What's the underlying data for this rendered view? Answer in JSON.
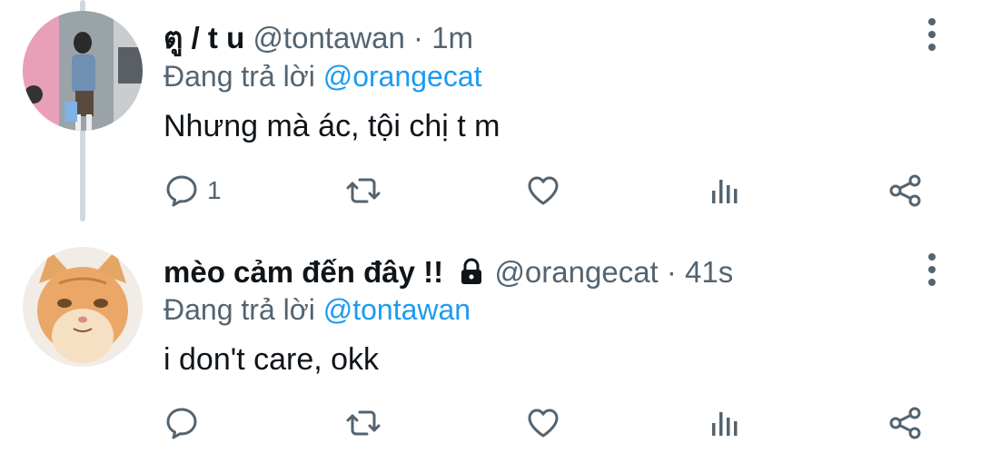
{
  "tweets": [
    {
      "display_name": "ตู / t u",
      "handle": "@tontawan",
      "time": "· 1m",
      "reply_prefix": "Đang trả lời",
      "reply_to": "@orangecat",
      "text": "Nhưng mà ác, tội chị t m",
      "reply_count": "1",
      "avatar": "girl-photo-avatar"
    },
    {
      "display_name": "mèo cảm đến đây !!",
      "handle": "@orangecat",
      "time": "· 41s",
      "reply_prefix": "Đang trả lời",
      "reply_to": "@tontawan",
      "text": "i don't care, okk",
      "reply_count": "",
      "avatar": "orange-cat-avatar",
      "protected": true
    }
  ],
  "icons": {
    "reply": "reply-bubble-icon",
    "retweet": "retweet-icon",
    "like": "heart-icon",
    "analytics": "analytics-bars-icon",
    "share": "share-icon",
    "more": "more-vertical-icon",
    "lock": "lock-icon"
  },
  "colors": {
    "text": "#0f1419",
    "secondary": "#536471",
    "mention": "#1d9bf0",
    "thread_line": "#cfd9de"
  }
}
